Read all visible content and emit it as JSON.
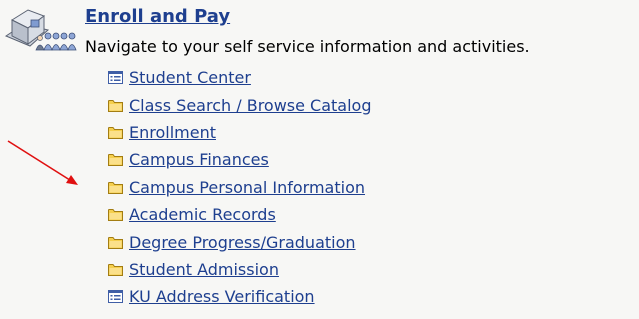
{
  "header": {
    "title": "Enroll and Pay",
    "subtitle": "Navigate to your self service information and activities."
  },
  "nav": {
    "items": [
      {
        "label": "Student Center",
        "icon": "list-page-icon"
      },
      {
        "label": "Class Search / Browse Catalog",
        "icon": "folder-icon"
      },
      {
        "label": "Enrollment",
        "icon": "folder-icon"
      },
      {
        "label": "Campus Finances",
        "icon": "folder-icon"
      },
      {
        "label": "Campus Personal Information",
        "icon": "folder-icon"
      },
      {
        "label": "Academic Records",
        "icon": "folder-icon"
      },
      {
        "label": "Degree Progress/Graduation",
        "icon": "folder-icon"
      },
      {
        "label": "Student Admission",
        "icon": "folder-icon"
      },
      {
        "label": "KU Address Verification",
        "icon": "list-page-icon"
      }
    ]
  },
  "colors": {
    "background": "#f7f7f5",
    "link": "#1e3f8f",
    "folder": "#f0c43c",
    "arrow": "#e01010"
  }
}
